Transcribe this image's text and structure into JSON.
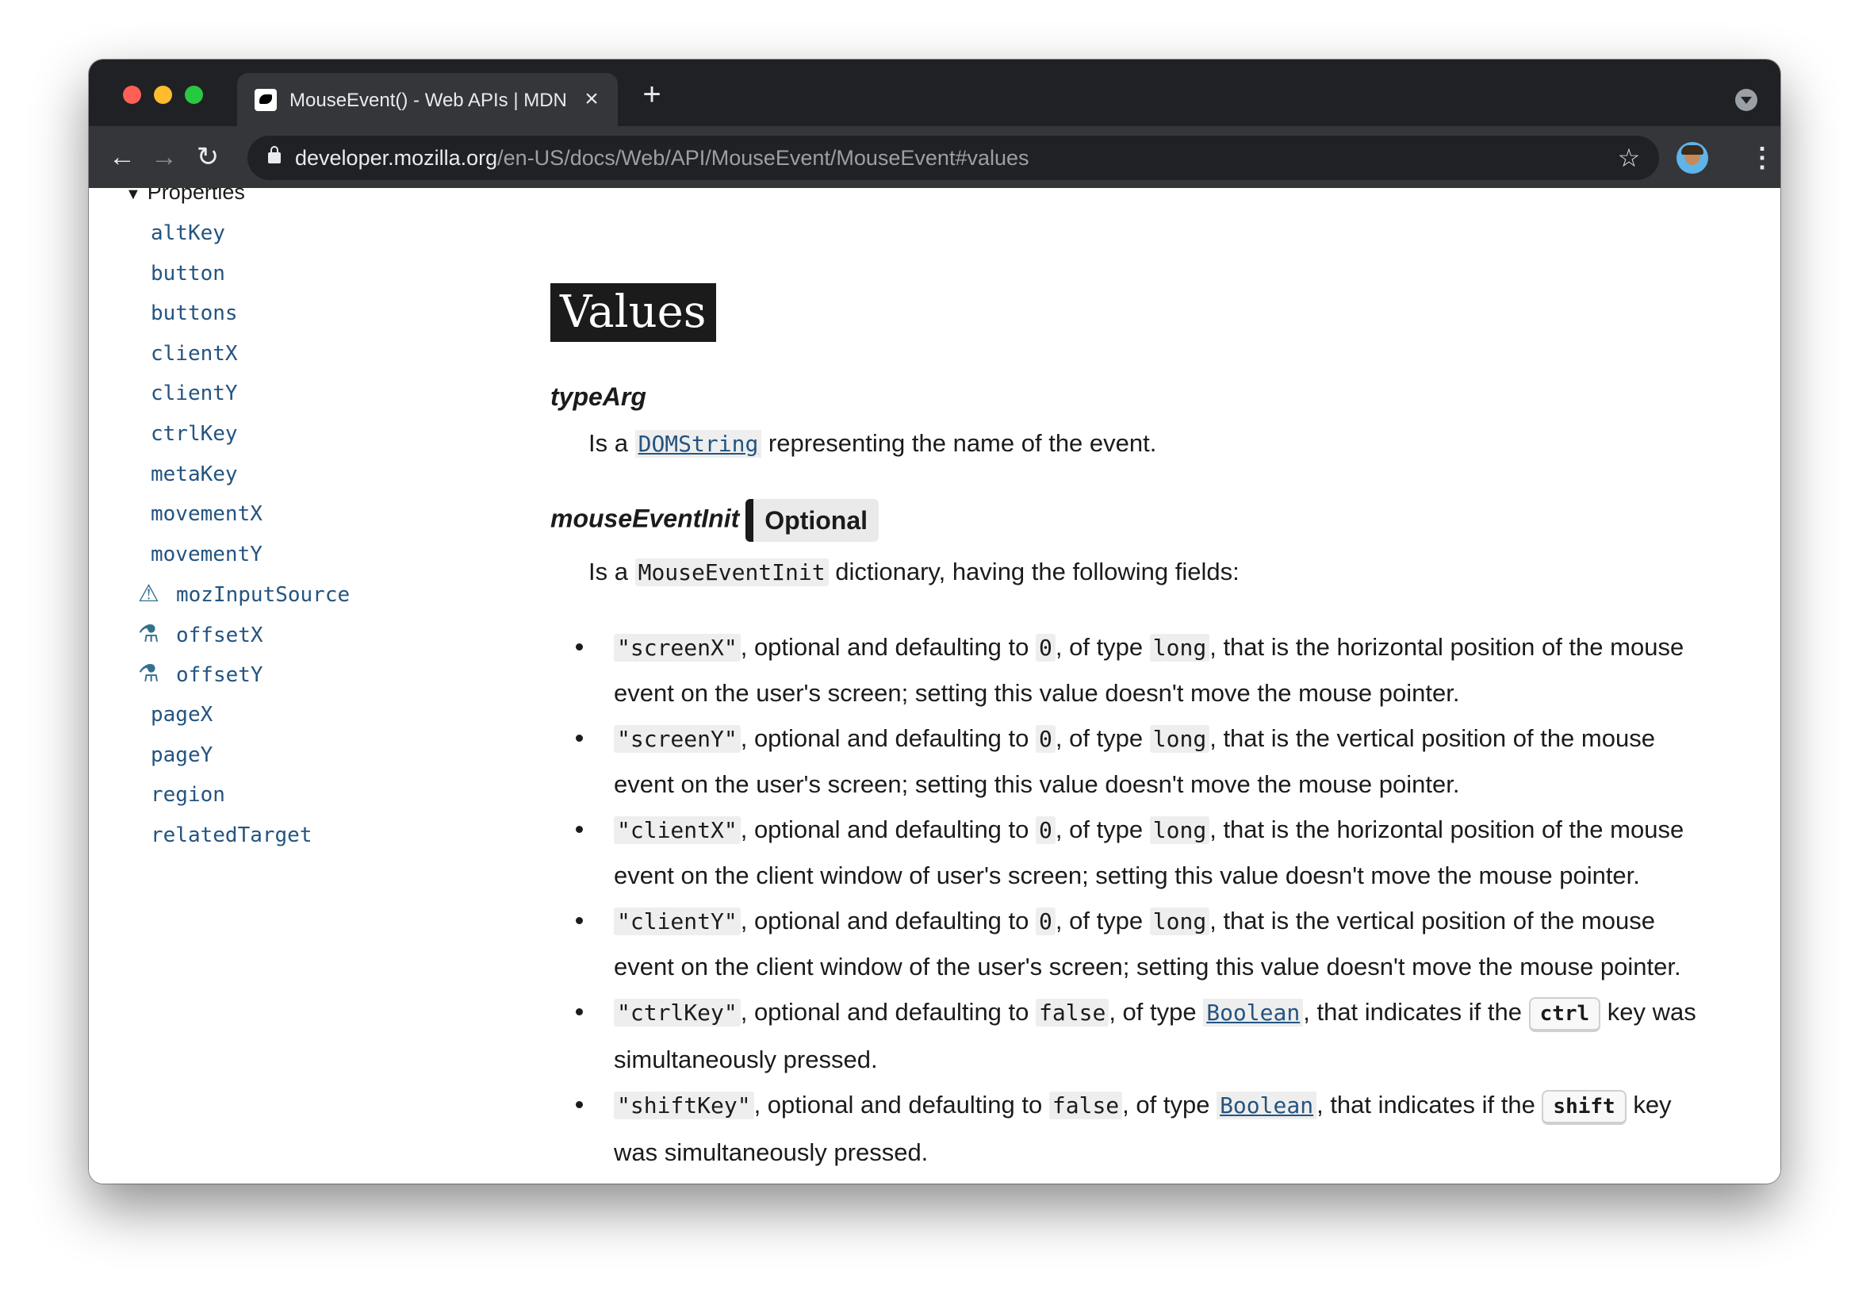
{
  "browser": {
    "tab_title": "MouseEvent() - Web APIs | MDN",
    "tab_close": "×",
    "new_tab": "+",
    "url_host": "developer.mozilla.org",
    "url_path": "/en-US/docs/Web/API/MouseEvent/MouseEvent#values",
    "back": "←",
    "forward": "→",
    "reload": "↻",
    "star": "☆",
    "menu": "⋮"
  },
  "sidebar": {
    "heading": "Properties",
    "items": [
      {
        "label": "altKey",
        "icon": ""
      },
      {
        "label": "button",
        "icon": ""
      },
      {
        "label": "buttons",
        "icon": ""
      },
      {
        "label": "clientX",
        "icon": ""
      },
      {
        "label": "clientY",
        "icon": ""
      },
      {
        "label": "ctrlKey",
        "icon": ""
      },
      {
        "label": "metaKey",
        "icon": ""
      },
      {
        "label": "movementX",
        "icon": ""
      },
      {
        "label": "movementY",
        "icon": ""
      },
      {
        "label": "mozInputSource",
        "icon": "warning-icon"
      },
      {
        "label": "offsetX",
        "icon": "experimental-flask-icon"
      },
      {
        "label": "offsetY",
        "icon": "experimental-flask-icon"
      },
      {
        "label": "pageX",
        "icon": ""
      },
      {
        "label": "pageY",
        "icon": ""
      },
      {
        "label": "region",
        "icon": ""
      },
      {
        "label": "relatedTarget",
        "icon": ""
      }
    ]
  },
  "main": {
    "heading": "Values",
    "typeArg": {
      "term": "typeArg",
      "desc_prefix": "Is a ",
      "desc_link": "DOMString",
      "desc_suffix": " representing the name of the event."
    },
    "mouseEventInit": {
      "term": "mouseEventInit",
      "badge": "Optional",
      "desc_prefix": "Is a ",
      "desc_code": "MouseEventInit",
      "desc_suffix": " dictionary, having the following fields:"
    },
    "fields": [
      {
        "name": "\"screenX\"",
        "t1": ", optional and defaulting to ",
        "default": "0",
        "t2": ", of type ",
        "type": "long",
        "t3": ", that is the horizontal position of the mouse event on the user's screen; setting this value doesn't move the mouse pointer."
      },
      {
        "name": "\"screenY\"",
        "t1": ", optional and defaulting to ",
        "default": "0",
        "t2": ", of type ",
        "type": "long",
        "t3": ", that is the vertical position of the mouse event on the user's screen; setting this value doesn't move the mouse pointer."
      },
      {
        "name": "\"clientX\"",
        "t1": ", optional and defaulting to ",
        "default": "0",
        "t2": ", of type ",
        "type": "long",
        "t3": ", that is the horizontal position of the mouse event on the client window of user's screen; setting this value doesn't move the mouse pointer."
      },
      {
        "name": "\"clientY\"",
        "t1": ", optional and defaulting to ",
        "default": "0",
        "t2": ", of type ",
        "type": "long",
        "t3": ", that is the vertical position of the mouse event on the client window of the user's screen; setting this value doesn't move the mouse pointer."
      }
    ],
    "ctrlKey": {
      "name": "\"ctrlKey\"",
      "t1": ", optional and defaulting to ",
      "default": "false",
      "t2": ", of type ",
      "type": "Boolean",
      "t3": ", that indicates if the ",
      "kbd": "ctrl",
      "t4": " key was simultaneously pressed."
    },
    "shiftKey": {
      "name": "\"shiftKey\"",
      "t1": ", optional and defaulting to ",
      "default": "false",
      "t2": ", of type ",
      "type": "Boolean",
      "t3": ", that indicates if the ",
      "kbd": "shift",
      "t4": " key was simultaneously pressed."
    }
  }
}
